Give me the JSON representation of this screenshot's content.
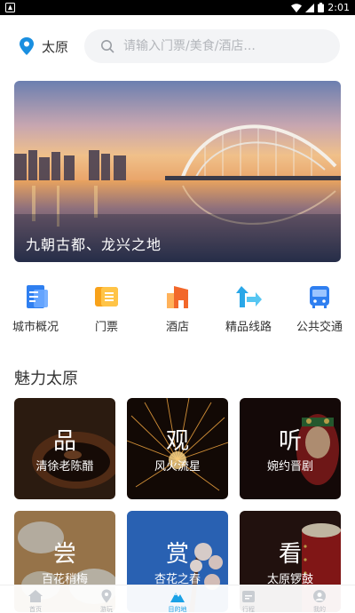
{
  "status_bar": {
    "time": "2:01"
  },
  "header": {
    "city": "太原",
    "search_placeholder": "请输入门票/美食/酒店..."
  },
  "banner": {
    "caption": "九朝古都、龙兴之地"
  },
  "categories": [
    {
      "label": "城市概况",
      "icon": "document-icon"
    },
    {
      "label": "门票",
      "icon": "ticket-icon"
    },
    {
      "label": "酒店",
      "icon": "hotel-icon"
    },
    {
      "label": "精品线路",
      "icon": "route-icon"
    },
    {
      "label": "公共交通",
      "icon": "bus-icon"
    }
  ],
  "section": {
    "title": "魅力太原"
  },
  "cards": [
    {
      "big": "品",
      "sub": "清徐老陈醋"
    },
    {
      "big": "观",
      "sub": "风火流星"
    },
    {
      "big": "听",
      "sub": "婉约晋剧"
    },
    {
      "big": "尝",
      "sub": "百花稍梅"
    },
    {
      "big": "赏",
      "sub": "杏花之春"
    },
    {
      "big": "看",
      "sub": "太原锣鼓"
    }
  ],
  "bottom_nav": [
    {
      "label": "首页",
      "icon": "home-icon"
    },
    {
      "label": "游玩",
      "icon": "location-icon"
    },
    {
      "label": "目的地",
      "icon": "mountain-icon",
      "active": true
    },
    {
      "label": "行程",
      "icon": "calendar-icon"
    },
    {
      "label": "我的",
      "icon": "user-icon"
    }
  ],
  "colors": {
    "accent": "#1aa1e6",
    "inactive": "#b8bcc2"
  }
}
